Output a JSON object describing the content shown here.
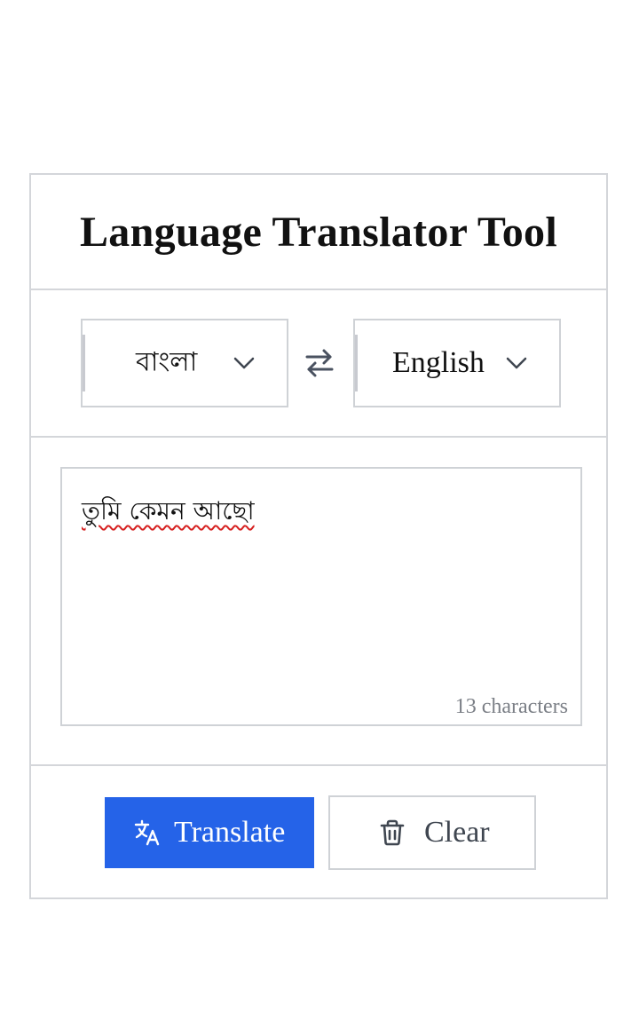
{
  "header": {
    "title": "Language Translator Tool"
  },
  "languages": {
    "source": "বাংলা",
    "target": "English"
  },
  "input": {
    "text": "তুমি কেমন আছো",
    "char_count": "13 characters"
  },
  "buttons": {
    "translate_label": "Translate",
    "clear_label": "Clear"
  },
  "icons": {
    "chevron": "chevron-down-icon",
    "swap": "swap-arrows-icon",
    "translate": "translate-icon",
    "clear": "trash-icon"
  },
  "colors": {
    "accent": "#2563e8",
    "border": "#d4d6da",
    "muted": "#7b7f86",
    "spell_error": "#d62020"
  }
}
